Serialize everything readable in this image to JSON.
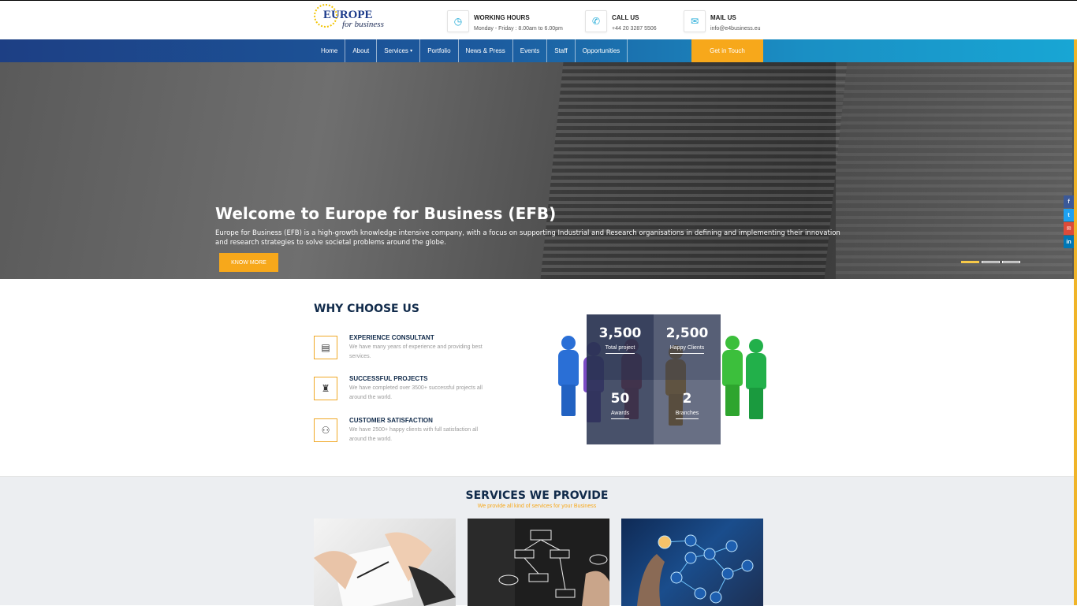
{
  "header": {
    "logo": {
      "line1": "EUROPE",
      "line2": "for business"
    },
    "info": [
      {
        "icon": "clock-icon",
        "title": "WORKING HOURS",
        "sub": "Monday - Friday : 8.00am to 6.00pm"
      },
      {
        "icon": "phone-icon",
        "title": "CALL US",
        "sub": "+44 20 3287 5506"
      },
      {
        "icon": "mail-icon",
        "title": "MAIL US",
        "sub": "info@e4business.eu"
      }
    ]
  },
  "nav": {
    "items": [
      "Home",
      "About",
      "Services",
      "Portfolio",
      "News & Press",
      "Events",
      "Staff",
      "Opportunities"
    ],
    "services_caret": "▾",
    "cta": "Get in Touch",
    "colors": {
      "start": "#1d3f84",
      "end": "#18a6d4",
      "cta": "#f7a81b"
    }
  },
  "hero": {
    "title": "Welcome to Europe for Business (EFB)",
    "text": "Europe for Business (EFB) is a high-growth knowledge intensive company, with a focus on supporting Industrial and Research organisations in defining and implementing their innovation and research strategies to solve societal problems around the globe.",
    "button": "KNOW MORE",
    "slides": 3,
    "active_slide": 1
  },
  "social": [
    {
      "icon": "facebook-icon",
      "glyph": "f",
      "color": "#3b5998"
    },
    {
      "icon": "twitter-icon",
      "glyph": "t",
      "color": "#1da1f2"
    },
    {
      "icon": "email-icon",
      "glyph": "✉",
      "color": "#dd4b39"
    },
    {
      "icon": "linkedin-icon",
      "glyph": "in",
      "color": "#0077b5"
    }
  ],
  "why": {
    "title": "WHY CHOOSE US",
    "features": [
      {
        "icon": "calendar-icon",
        "glyph": "▤",
        "title": "EXPERIENCE CONSULTANT",
        "text": "We have many years of experience and providing best services."
      },
      {
        "icon": "trophy-icon",
        "glyph": "♜",
        "title": "SUCCESSFUL PROJECTS",
        "text": "We have completed over 3500+ successful projects all around the world."
      },
      {
        "icon": "network-icon",
        "glyph": "⚇",
        "title": "CUSTOMER SATISFACTION",
        "text": "We have 2500+ happy clients with full satisfaction all around the world."
      }
    ],
    "stats": [
      {
        "value": "3,500",
        "label": "Total project"
      },
      {
        "value": "2,500",
        "label": "Happy Clients"
      },
      {
        "value": "50",
        "label": "Awards"
      },
      {
        "value": "2",
        "label": "Branches"
      }
    ]
  },
  "services": {
    "title": "SERVICES WE PROVIDE",
    "subtitle": "We provide all kind of services for your Business"
  }
}
